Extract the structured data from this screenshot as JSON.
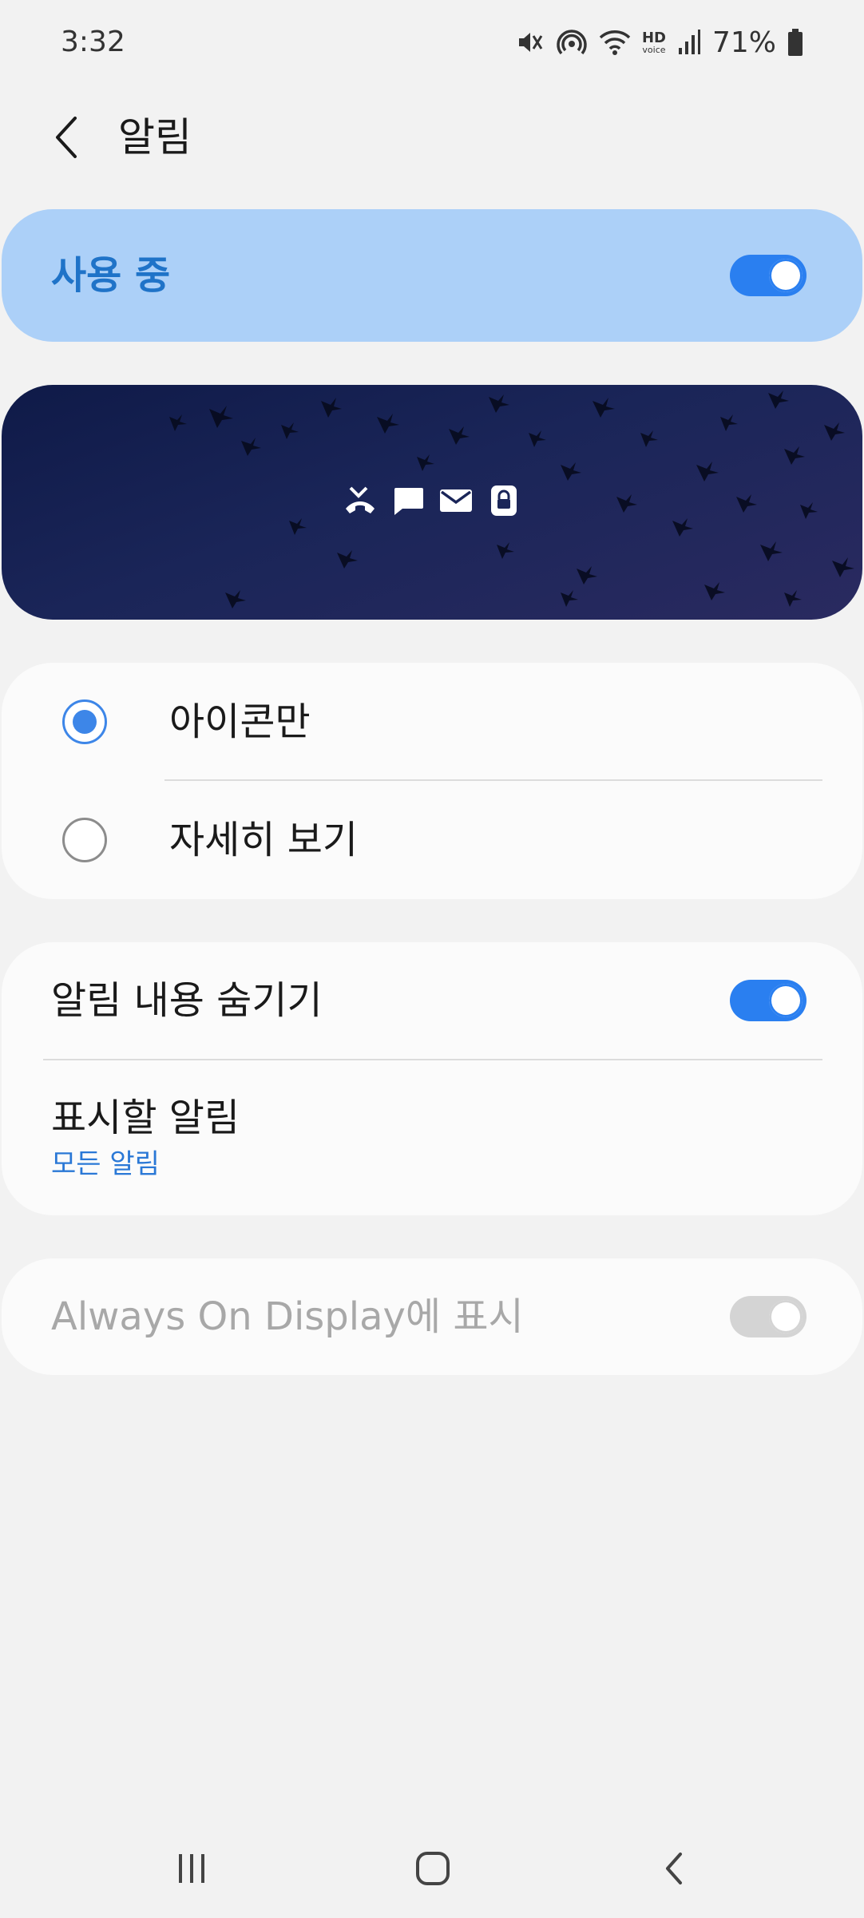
{
  "status_bar": {
    "time": "3:32",
    "battery_percent": "71%",
    "hd_label": "HD",
    "voice_label": "voice",
    "icons": [
      "mute-icon",
      "hotspot-icon",
      "wifi-icon",
      "hd-voice-icon",
      "signal-icon",
      "battery-icon"
    ]
  },
  "header": {
    "title": "알림",
    "back_icon": "chevron-left-icon"
  },
  "master_switch": {
    "label": "사용 중",
    "enabled": true
  },
  "preview": {
    "icons": [
      "missed-call-icon",
      "message-icon",
      "email-icon",
      "lock-icon"
    ]
  },
  "style_options": {
    "items": [
      {
        "label": "아이콘만",
        "selected": true
      },
      {
        "label": "자세히 보기",
        "selected": false
      }
    ]
  },
  "content": {
    "hide_content_label": "알림 내용 숨기기",
    "hide_content_enabled": true,
    "notifications_to_show_label": "표시할 알림",
    "notifications_to_show_value": "모든 알림"
  },
  "aod": {
    "label": "Always On Display에 표시",
    "enabled": false,
    "disabled": true
  },
  "colors": {
    "accent": "#2a7ff0",
    "master_card": "#acd0f8",
    "master_label": "#1f73c8",
    "background": "#f2f2f2",
    "disabled_text": "#a8a8a8"
  },
  "nav_bar": {
    "icons": [
      "recents-icon",
      "home-icon",
      "back-icon"
    ]
  }
}
